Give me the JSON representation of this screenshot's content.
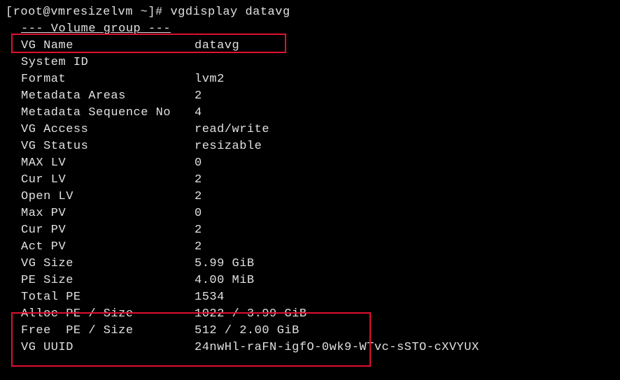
{
  "prompt": {
    "userhost": "[root@vmresizelvm ~]# ",
    "command": "vgdisplay datavg"
  },
  "section_header": "--- Volume group ---",
  "rows": [
    {
      "label": "VG Name",
      "value": "datavg"
    },
    {
      "label": "System ID",
      "value": ""
    },
    {
      "label": "Format",
      "value": "lvm2"
    },
    {
      "label": "Metadata Areas",
      "value": "2"
    },
    {
      "label": "Metadata Sequence No",
      "value": "4"
    },
    {
      "label": "VG Access",
      "value": "read/write"
    },
    {
      "label": "VG Status",
      "value": "resizable"
    },
    {
      "label": "MAX LV",
      "value": "0"
    },
    {
      "label": "Cur LV",
      "value": "2"
    },
    {
      "label": "Open LV",
      "value": "2"
    },
    {
      "label": "Max PV",
      "value": "0"
    },
    {
      "label": "Cur PV",
      "value": "2"
    },
    {
      "label": "Act PV",
      "value": "2"
    },
    {
      "label": "VG Size",
      "value": "5.99 GiB"
    },
    {
      "label": "PE Size",
      "value": "4.00 MiB"
    },
    {
      "label": "Total PE",
      "value": "1534"
    },
    {
      "label": "Alloc PE / Size",
      "value": "1022 / 3.99 GiB"
    },
    {
      "label": "Free  PE / Size",
      "value": "512 / 2.00 GiB"
    },
    {
      "label": "VG UUID",
      "value": "24nwHl-raFN-igfO-0wk9-WTvc-sSTO-cXVYUX"
    }
  ]
}
